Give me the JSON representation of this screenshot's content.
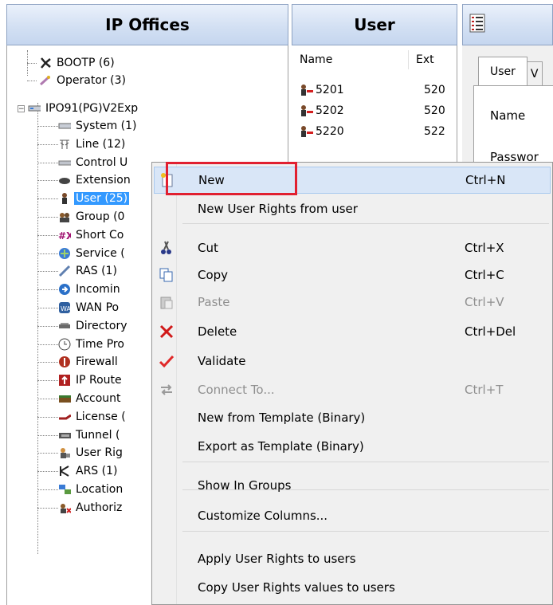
{
  "headers": {
    "left": "IP Offices",
    "middle": "User"
  },
  "tree": {
    "top_items": [
      {
        "label": "BOOTP (6)",
        "icon": "bootp-icon"
      },
      {
        "label": "Operator (3)",
        "icon": "operator-icon"
      }
    ],
    "root": {
      "label": "IPO91(PG)V2Exp",
      "expander": "−"
    },
    "children": [
      {
        "label": "System (1)",
        "icon": "system-icon"
      },
      {
        "label": "Line (12)",
        "icon": "line-icon"
      },
      {
        "label": "Control U",
        "icon": "control-unit-icon"
      },
      {
        "label": "Extension",
        "icon": "extension-icon"
      },
      {
        "label": "User (25)",
        "icon": "user-icon",
        "selected": true
      },
      {
        "label": "Group (0",
        "icon": "group-icon"
      },
      {
        "label": "Short Co",
        "icon": "short-code-icon"
      },
      {
        "label": "Service (",
        "icon": "service-icon"
      },
      {
        "label": "RAS (1)",
        "icon": "ras-icon"
      },
      {
        "label": "Incomin",
        "icon": "incoming-call-route-icon"
      },
      {
        "label": "WAN Po",
        "icon": "wan-port-icon"
      },
      {
        "label": "Directory",
        "icon": "directory-icon"
      },
      {
        "label": "Time Pro",
        "icon": "time-profile-icon"
      },
      {
        "label": "Firewall",
        "icon": "firewall-icon"
      },
      {
        "label": "IP Route",
        "icon": "ip-route-icon"
      },
      {
        "label": "Account",
        "icon": "account-code-icon"
      },
      {
        "label": "License (",
        "icon": "license-icon"
      },
      {
        "label": "Tunnel (",
        "icon": "tunnel-icon"
      },
      {
        "label": "User Rig",
        "icon": "user-rights-icon"
      },
      {
        "label": "ARS (1)",
        "icon": "ars-icon"
      },
      {
        "label": "Location",
        "icon": "location-icon"
      },
      {
        "label": "Authoriz",
        "icon": "authorization-icon"
      }
    ]
  },
  "list": {
    "col_name": "Name",
    "col_ext": "Ext",
    "rows": [
      {
        "name": "5201",
        "ext": "520"
      },
      {
        "name": "5202",
        "ext": "520"
      },
      {
        "name": "5220",
        "ext": "522"
      }
    ]
  },
  "details": {
    "tab_user": "User",
    "tab_next": "V",
    "name_label": "Name",
    "password_label": "Passwor"
  },
  "context_menu": {
    "items": [
      {
        "label": "New",
        "shortcut": "Ctrl+N",
        "icon": "new-icon",
        "highlighted": true
      },
      {
        "label": "New User Rights from user",
        "shortcut": ""
      },
      {
        "label": "Cut",
        "shortcut": "Ctrl+X",
        "icon": "cut-icon"
      },
      {
        "label": "Copy",
        "shortcut": "Ctrl+C",
        "icon": "copy-icon"
      },
      {
        "label": "Paste",
        "shortcut": "Ctrl+V",
        "icon": "paste-icon",
        "disabled": true
      },
      {
        "label": "Delete",
        "shortcut": "Ctrl+Del",
        "icon": "delete-icon"
      },
      {
        "label": "Validate",
        "shortcut": "",
        "icon": "validate-icon"
      },
      {
        "label": "Connect To...",
        "shortcut": "Ctrl+T",
        "icon": "connect-icon",
        "disabled": true
      },
      {
        "label": "New from Template (Binary)",
        "shortcut": ""
      },
      {
        "label": "Export as Template (Binary)",
        "shortcut": ""
      },
      {
        "label": "Show In Groups",
        "shortcut": ""
      },
      {
        "label": "Customize Columns...",
        "shortcut": ""
      },
      {
        "label": "Apply User Rights to users",
        "shortcut": ""
      },
      {
        "label": "Copy User Rights values to users",
        "shortcut": ""
      }
    ]
  },
  "colors": {
    "selection": "#3399ff",
    "highlight_box": "#e12030",
    "menu_hover": "#d9e6f7"
  }
}
